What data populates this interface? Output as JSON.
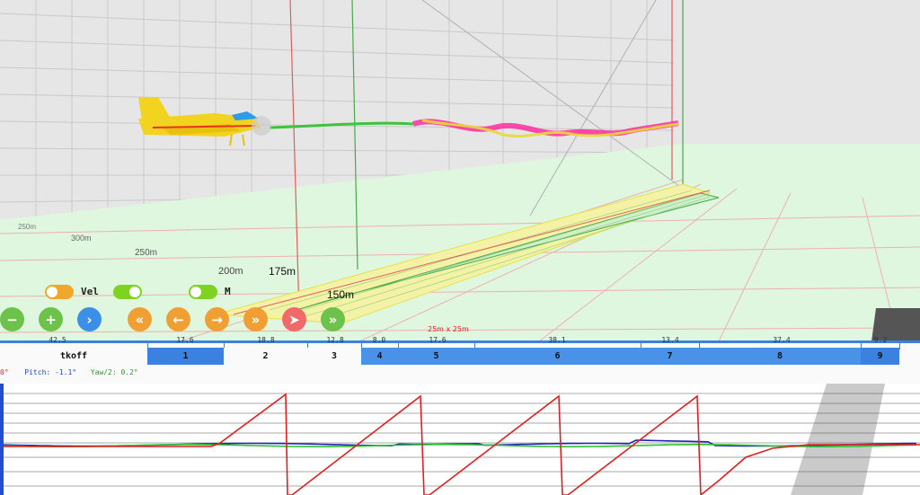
{
  "scene": {
    "colors": {
      "sky": "#e6e6e6",
      "ground": "#dff7df",
      "grid_red": "#e35b5b",
      "grid_green": "#4aa84a",
      "grid_yellow": "#e3e34a"
    },
    "distance_labels": [
      "250m",
      "300m",
      "250m",
      "200m",
      "175m",
      "150m"
    ],
    "grid_size": "25m x 25m",
    "aircraft": {
      "fuselage_color": "#f2d320",
      "canopy_color": "#2c9be8",
      "accent_color": "#e8331f"
    }
  },
  "controls": {
    "toggles": [
      {
        "label": "",
        "on": false,
        "color": "#f1a72c"
      },
      {
        "label": "Vel",
        "on": true,
        "color": "#7ed321"
      },
      {
        "label": "M",
        "on": true,
        "color": "#7ed321"
      }
    ],
    "buttons": [
      {
        "icon": "minus-icon",
        "glyph": "−",
        "color": "#6cc24a"
      },
      {
        "icon": "plus-icon",
        "glyph": "+",
        "color": "#6cc24a"
      },
      {
        "icon": "chevron-right-icon",
        "glyph": "›",
        "color": "#3b8fe6"
      },
      {
        "icon": "rewind-icon",
        "glyph": "«",
        "color": "#f0a033"
      },
      {
        "icon": "arrow-left-icon",
        "glyph": "←",
        "color": "#f0a033"
      },
      {
        "icon": "arrow-right-icon",
        "glyph": "→",
        "color": "#f0a033"
      },
      {
        "icon": "fast-forward-icon",
        "glyph": "»",
        "color": "#f0a033"
      },
      {
        "icon": "send-icon",
        "glyph": "➤",
        "color": "#f06a6a"
      },
      {
        "icon": "double-chevron-right-icon",
        "glyph": "»",
        "color": "#6cc24a"
      }
    ]
  },
  "timeline": {
    "accent": "#3b82e0",
    "segments": [
      {
        "label": "tkoff",
        "duration": "42.5",
        "active": false
      },
      {
        "label": "1",
        "duration": "17.6",
        "active": true
      },
      {
        "label": "2",
        "duration": "18.8",
        "active": false
      },
      {
        "label": "3",
        "duration": "12.8",
        "active": false
      },
      {
        "label": "4",
        "duration": "8.0",
        "active": true
      },
      {
        "label": "5",
        "duration": "17.6",
        "active": true
      },
      {
        "label": "6",
        "duration": "38.1",
        "active": true
      },
      {
        "label": "7",
        "duration": "13.4",
        "active": true
      },
      {
        "label": "8",
        "duration": "37.4",
        "active": true
      },
      {
        "label": "9",
        "duration": "9.2",
        "active": true
      }
    ]
  },
  "attitude": {
    "roll": "0°",
    "pitch": "Pitch: -1.1°",
    "yaw": "Yaw/2: 0.2°"
  },
  "plot": {
    "colors": {
      "red": "#e02020",
      "blue": "#2020c0",
      "green": "#30c030"
    },
    "red_peaks": [
      0.93,
      0.93,
      0.93,
      0.93
    ],
    "baseline": 0.5
  }
}
